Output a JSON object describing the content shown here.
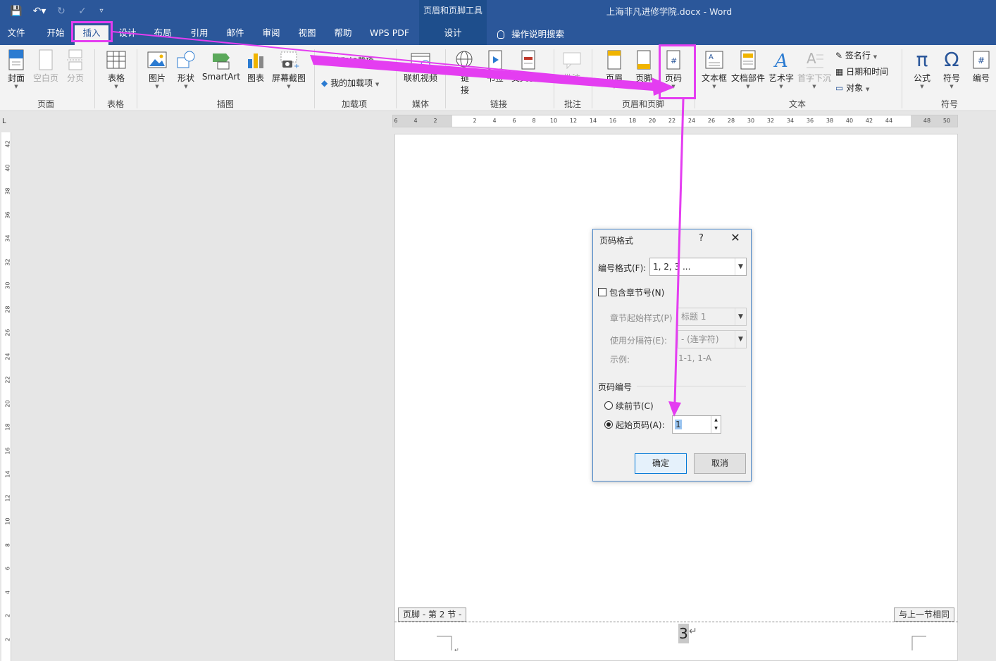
{
  "titlebar": {
    "doc_title": "上海非凡进修学院.docx  -  Word",
    "context_tool": "页眉和页脚工具",
    "tell_me": "操作说明搜索",
    "colors": {
      "bar": "#2b579a",
      "highlight": "#e43df1"
    }
  },
  "tabs": [
    "文件",
    "开始",
    "插入",
    "设计",
    "布局",
    "引用",
    "邮件",
    "审阅",
    "视图",
    "帮助",
    "WPS PDF",
    "设计"
  ],
  "ribbon": {
    "groups": [
      "页面",
      "表格",
      "插图",
      "加载项",
      "媒体",
      "链接",
      "批注",
      "页眉和页脚",
      "文本",
      "符号"
    ],
    "buttons": {
      "cover": "封面",
      "blank": "空白页",
      "break": "分页",
      "table": "表格",
      "picture": "图片",
      "shape": "形状",
      "smartart": "SmartArt",
      "chart": "图表",
      "screenshot": "屏幕截图",
      "get_addin": "获取加载项",
      "my_addin": "我的加载项",
      "video": "联机视频",
      "link_1": "链",
      "link_2": "接",
      "bookmark": "书签",
      "crossref": "交叉引用",
      "comment": "批注",
      "header": "页眉",
      "footer": "页脚",
      "pagenum": "页码",
      "textbox": "文本框",
      "parts": "文档部件",
      "wordart": "艺术字",
      "dropcap": "首字下沉",
      "sigline": "签名行",
      "datetime": "日期和时间",
      "object": "对象",
      "equation": "公式",
      "symbol": "符号",
      "number": "编号"
    }
  },
  "ruler": {
    "h_numbers": [
      "6",
      "4",
      "2",
      "2",
      "4",
      "6",
      "8",
      "10",
      "12",
      "14",
      "16",
      "18",
      "20",
      "22",
      "24",
      "26",
      "28",
      "30",
      "32",
      "34",
      "36",
      "38",
      "40",
      "42",
      "44",
      "48",
      "50"
    ],
    "v_numbers": [
      "42",
      "40",
      "38",
      "36",
      "34",
      "32",
      "30",
      "28",
      "26",
      "24",
      "22",
      "20",
      "18",
      "16",
      "14",
      "12",
      "10",
      "8",
      "6",
      "4",
      "2",
      "2"
    ],
    "corner": "L"
  },
  "document": {
    "footer_tag": "页脚 - 第 2 节 -",
    "same_as_prev": "与上一节相同",
    "page_number": "3",
    "para_mark": "↵"
  },
  "dialog": {
    "title": "页码格式",
    "help": "?",
    "close": "✕",
    "format_label": "编号格式(F):",
    "format_value": "1, 2, 3 ...",
    "include_chapter": "包含章节号(N)",
    "chapter_style_label": "章节起始样式(P)",
    "chapter_style_value": "标题 1",
    "separator_label": "使用分隔符(E):",
    "separator_value": "-  (连字符)",
    "example_label": "示例:",
    "example_value": "1-1, 1-A",
    "section_label": "页码编号",
    "continue_label": "续前节(C)",
    "start_label": "起始页码(A):",
    "start_value": "1",
    "ok": "确定",
    "cancel": "取消"
  }
}
